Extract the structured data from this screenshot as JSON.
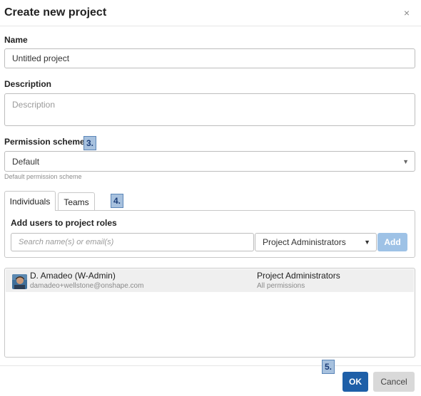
{
  "dialog": {
    "title": "Create new project",
    "close_glyph": "×"
  },
  "name": {
    "label": "Name",
    "value": "Untitled project"
  },
  "description": {
    "label": "Description",
    "placeholder": "Description"
  },
  "permission": {
    "label": "Permission scheme",
    "selected": "Default",
    "hint": "Default permission scheme"
  },
  "tabs": [
    {
      "label": "Individuals",
      "active": true
    },
    {
      "label": "Teams",
      "active": false
    }
  ],
  "add_users": {
    "heading": "Add users to project roles",
    "search_placeholder": "Search name(s) or email(s)",
    "role_selected": "Project Administrators",
    "add_label": "Add"
  },
  "members": [
    {
      "name": "D. Amadeo (W-Admin)",
      "email": "damadeo+wellstone@onshape.com",
      "role": "Project Administrators",
      "permissions": "All permissions"
    }
  ],
  "callouts": [
    "3.",
    "4.",
    "5."
  ],
  "footer": {
    "ok_label": "OK",
    "cancel_label": "Cancel"
  },
  "colors": {
    "primary": "#1e5fa8",
    "add_button": "#9ec2e6",
    "callout_fill": "#a7c1de",
    "callout_border": "#5b86b8"
  },
  "icons": {
    "close": "close-icon",
    "dropdown": "chevron-down-icon"
  }
}
